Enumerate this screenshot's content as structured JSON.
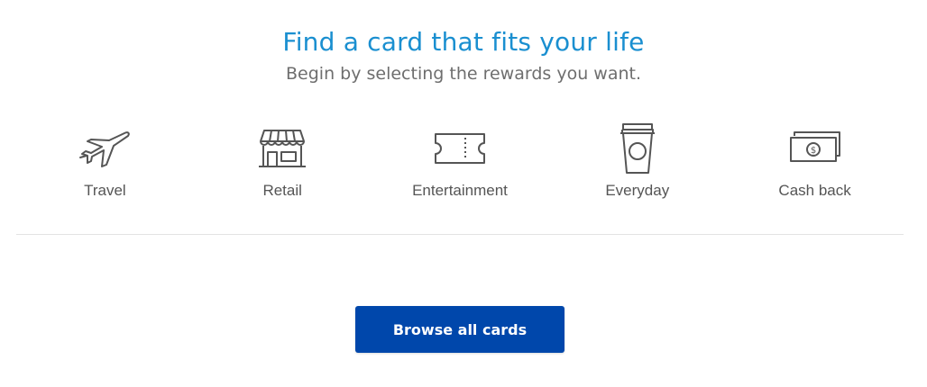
{
  "header": {
    "title": "Find a card that fits your life",
    "subtitle": "Begin by selecting the rewards you want."
  },
  "rewards": [
    {
      "label": "Travel",
      "icon": "airplane-icon"
    },
    {
      "label": "Retail",
      "icon": "storefront-icon"
    },
    {
      "label": "Entertainment",
      "icon": "ticket-icon"
    },
    {
      "label": "Everyday",
      "icon": "coffee-cup-icon"
    },
    {
      "label": "Cash back",
      "icon": "cash-icon"
    }
  ],
  "browse": {
    "label": "Browse all cards"
  },
  "colors": {
    "title": "#1a8fd0",
    "button": "#0047ab",
    "icon_stroke": "#555555"
  }
}
